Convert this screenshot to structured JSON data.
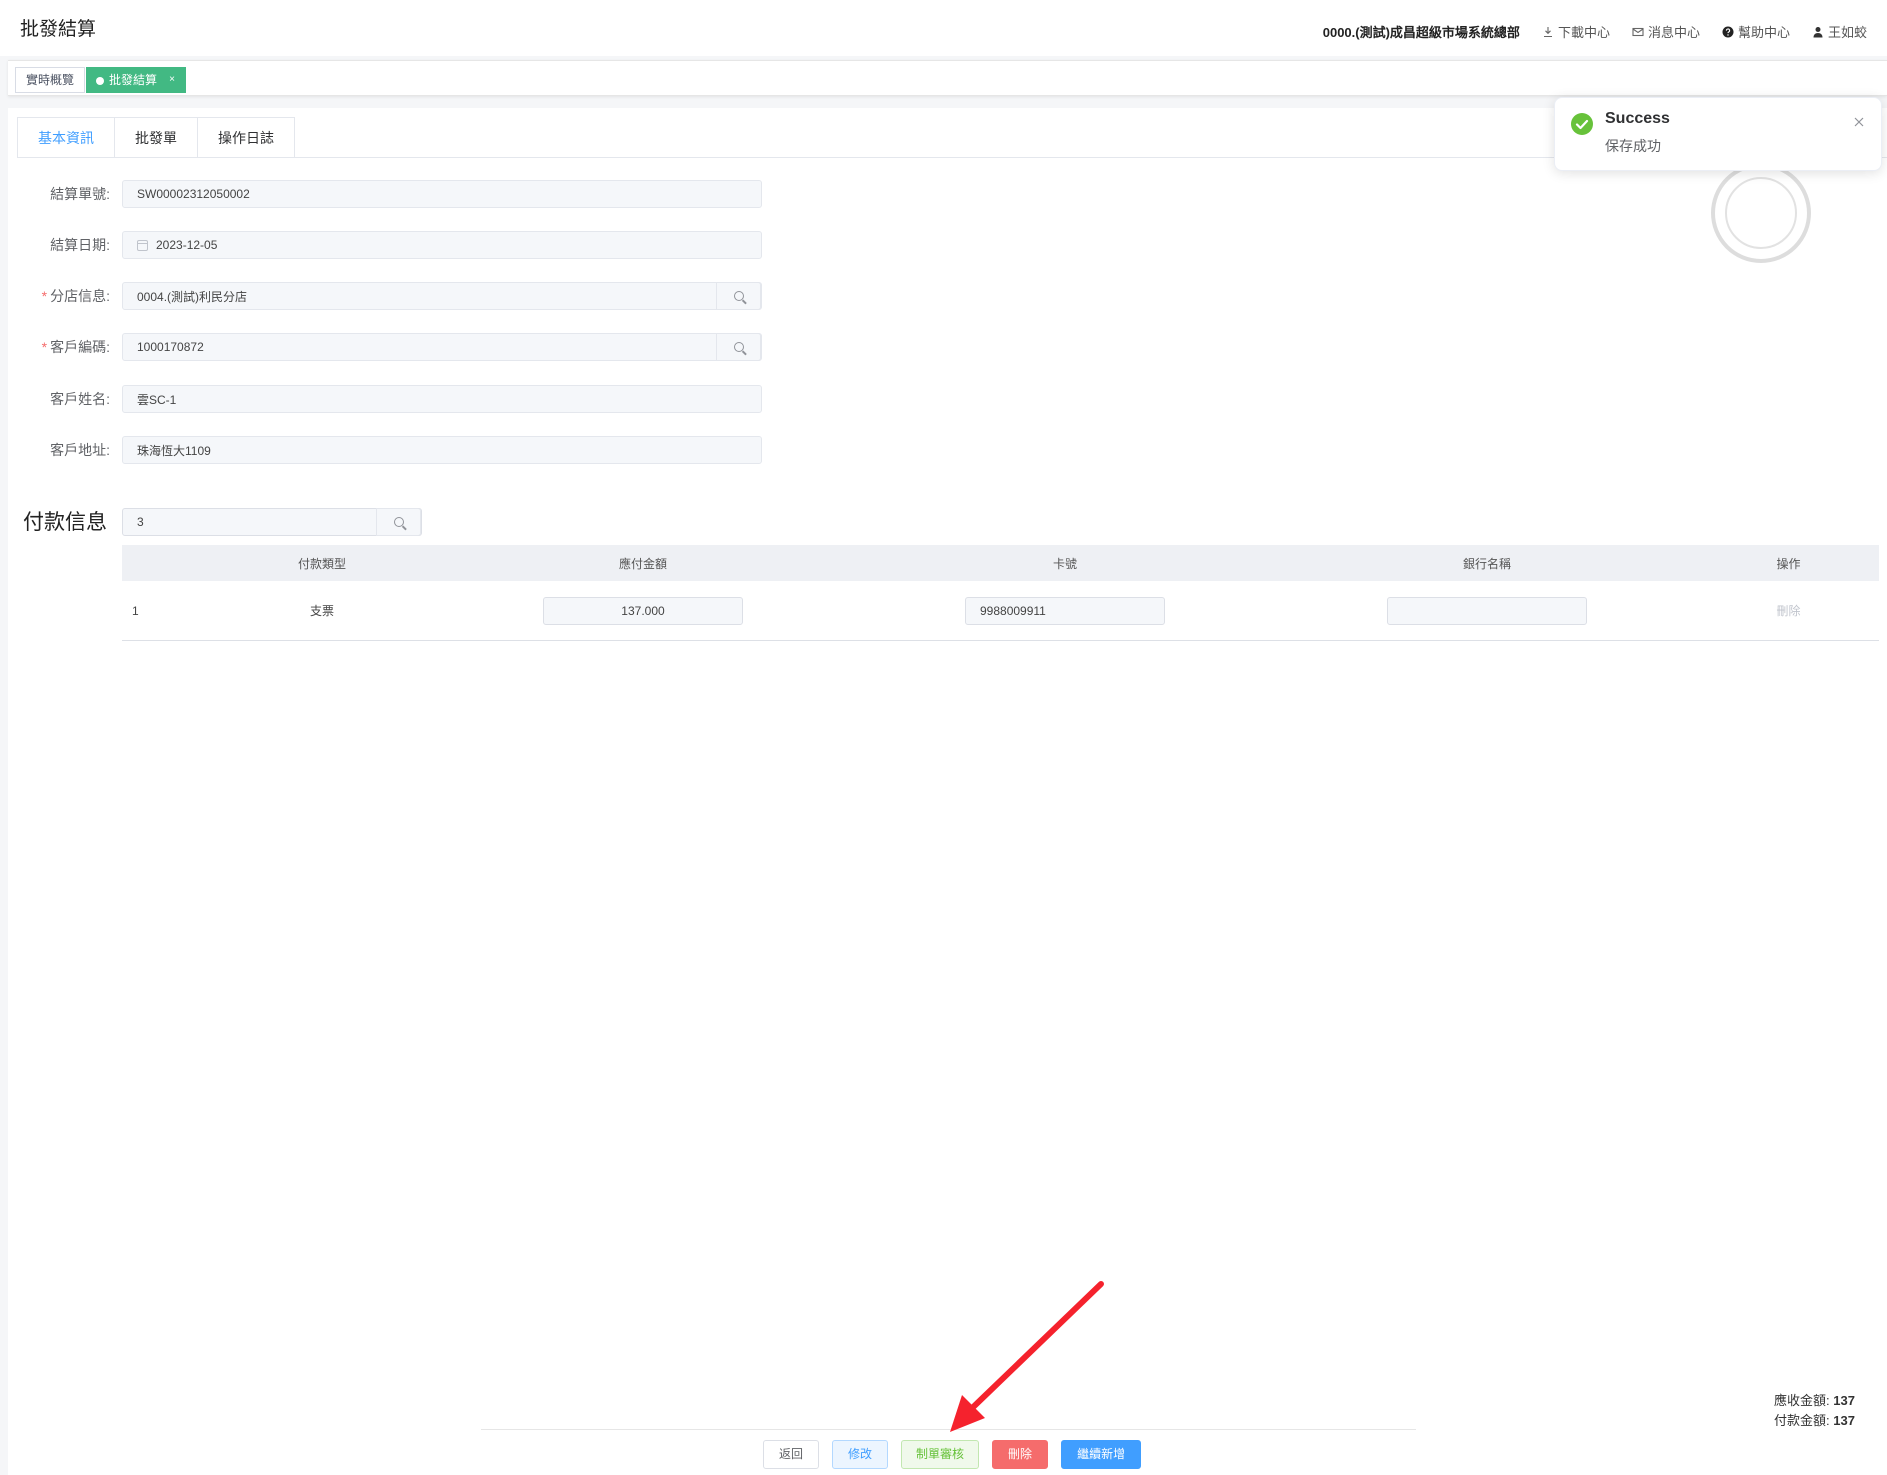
{
  "header": {
    "title": "批發結算",
    "org": "0000.(測試)成昌超級市場系統總部",
    "download": "下載中心",
    "messages": "消息中心",
    "help": "幫助中心",
    "user": "王如蛟"
  },
  "tags": {
    "overview": "實時概覽",
    "active": "批發結算",
    "close": "×"
  },
  "tabs": [
    "基本資訊",
    "批發單",
    "操作日誌"
  ],
  "form": {
    "settlement_no": {
      "label": "結算單號:",
      "value": "SW00002312050002"
    },
    "settlement_date": {
      "label": "結算日期:",
      "value": "2023-12-05"
    },
    "branch": {
      "label": "分店信息:",
      "value": "0004.(測試)利民分店",
      "required": "*"
    },
    "customer_code": {
      "label": "客戶編碼:",
      "value": "1000170872",
      "required": "*"
    },
    "customer_name": {
      "label": "客戶姓名:",
      "value": "雲SC-1"
    },
    "customer_address": {
      "label": "客戶地址:",
      "value": "珠海恆大1109"
    }
  },
  "payment": {
    "title": "付款信息",
    "search_value": "3",
    "headers": [
      "",
      "付款類型",
      "應付金額",
      "卡號",
      "銀行名稱",
      "操作"
    ],
    "rows": [
      {
        "index": "1",
        "type": "支票",
        "amount": "137.000",
        "card": "9988009911",
        "bank": "",
        "action": "刪除"
      }
    ]
  },
  "totals": {
    "receivable_label": "應收金額:",
    "receivable_value": "137",
    "paid_label": "付款金額:",
    "paid_value": "137"
  },
  "buttons": {
    "back": "返回",
    "edit": "修改",
    "audit": "制單審核",
    "delete": "刪除",
    "continue": "繼續新增"
  },
  "toast": {
    "title": "Success",
    "message": "保存成功"
  },
  "colors": {
    "primary": "#409eff",
    "success": "#67c23a",
    "danger": "#f56c6c",
    "tag_active": "#42b983",
    "arrow": "#f5222d"
  }
}
